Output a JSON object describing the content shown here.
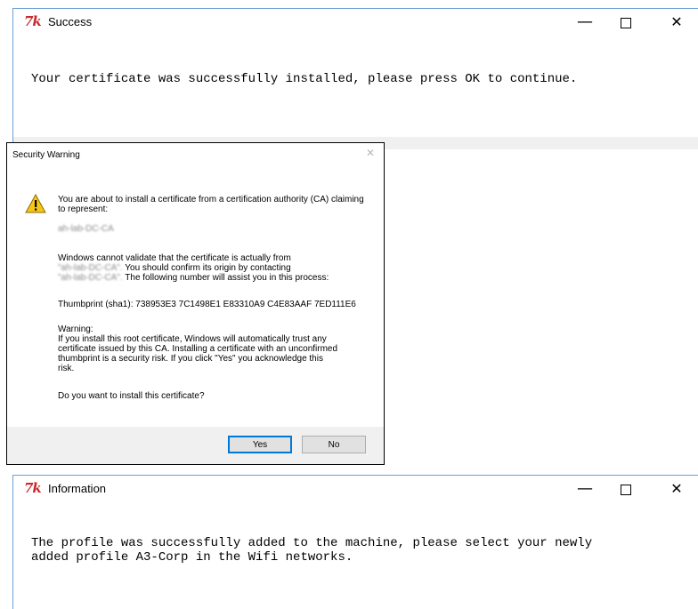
{
  "success_window": {
    "logo": "7k",
    "title": "Success",
    "message": "Your certificate was successfully installed, please press OK to continue.",
    "minimize": "—",
    "close": "✕"
  },
  "security_dialog": {
    "title": "Security Warning",
    "close": "✕",
    "intro": "You are about to install a certificate from a certification authority (CA) claiming to represent:",
    "ca_name": "ah-lab-DC-CA",
    "validate_prefix": "Windows cannot validate that the certificate is actually from",
    "validate_ca_1": "\"ah-lab-DC-CA\".",
    "validate_mid": " You should confirm its origin by contacting",
    "validate_ca_2": "\"ah-lab-DC-CA\".",
    "validate_suffix": " The following number will assist you in this process:",
    "thumbprint": "Thumbprint (sha1): 738953E3 7C1498E1 E83310A9 C4E83AAF 7ED111E6",
    "warning_heading": "Warning:",
    "warning_body_1": "If you install this root certificate, Windows will automatically trust any",
    "warning_body_2": "certificate issued by this CA. Installing a certificate with an unconfirmed",
    "warning_body_3": "thumbprint is a security risk. If you click \"Yes\" you acknowledge this",
    "warning_body_4": "risk.",
    "question": "Do you want to install this certificate?",
    "yes_label": "Yes",
    "no_label": "No"
  },
  "info_window": {
    "logo": "7k",
    "title": "Information",
    "message_line1": "The profile was successfully added to the machine, please select your newly",
    "message_line2": "added profile A3-Corp in the Wifi networks.",
    "minimize": "—",
    "close": "✕"
  },
  "icons": {
    "tk_logo": "tk-feather-icon",
    "warning": "warning-triangle-icon"
  },
  "colors": {
    "tk_logo": "#c9282d",
    "window_border": "#6b9fd4",
    "warning_yellow": "#f5c518",
    "button_default_border": "#0078d7"
  }
}
